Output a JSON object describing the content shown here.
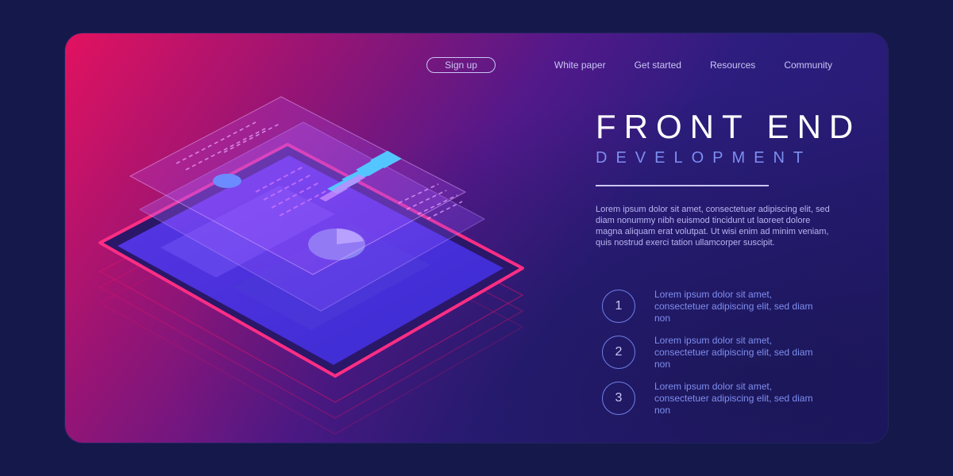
{
  "nav": {
    "signup": "Sign up",
    "links": [
      "White paper",
      "Get started",
      "Resources",
      "Community"
    ]
  },
  "hero": {
    "title": "FRONT END",
    "subtitle": "DEVELOPMENT",
    "body": "Lorem ipsum dolor sit amet, consectetuer adipiscing elit, sed diam nonummy nibh euismod tincidunt ut laoreet dolore magna aliquam erat volutpat. Ut wisi enim ad minim veniam, quis nostrud exerci tation ullamcorper suscipit."
  },
  "steps": [
    {
      "number": "1",
      "text": "Lorem ipsum dolor sit amet, consectetuer adipiscing elit, sed diam non"
    },
    {
      "number": "2",
      "text": "Lorem ipsum dolor sit amet, consectetuer adipiscing elit, sed diam non"
    },
    {
      "number": "3",
      "text": "Lorem ipsum dolor sit amet, consectetuer adipiscing elit, sed diam non"
    }
  ],
  "colors": {
    "background": "#15184a",
    "accent_pink": "#e2125f",
    "accent_blue": "#7e8ef0",
    "text_light": "#c9c6f4"
  }
}
